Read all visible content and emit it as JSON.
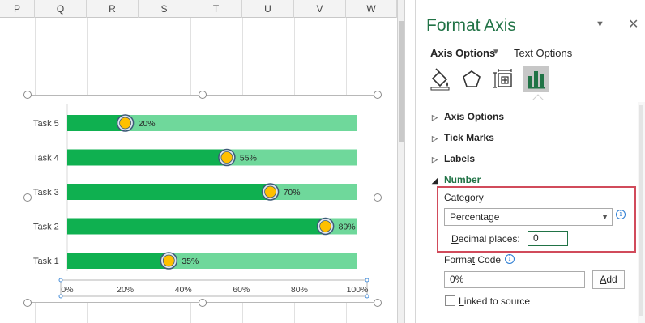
{
  "sheet": {
    "columns": [
      "P",
      "Q",
      "R",
      "S",
      "T",
      "U",
      "V",
      "W"
    ]
  },
  "chart_data": {
    "type": "bar",
    "orientation": "horizontal",
    "categories": [
      "Task 1",
      "Task 2",
      "Task 3",
      "Task 4",
      "Task 5"
    ],
    "values": [
      0.35,
      0.89,
      0.7,
      0.55,
      0.2
    ],
    "data_labels": [
      "35%",
      "89%",
      "70%",
      "55%",
      "20%"
    ],
    "xlim": [
      0,
      1
    ],
    "x_ticks": [
      "0%",
      "20%",
      "40%",
      "60%",
      "80%",
      "100%"
    ],
    "grid": false,
    "colors": {
      "progress": "#0fb050",
      "remaining": "#6fd89b",
      "marker_fill": "#ffc000",
      "marker_ring": "#3c5a78"
    }
  },
  "pane": {
    "title": "Format Axis",
    "tabs": {
      "axis_options": "Axis Options",
      "text_options": "Text Options"
    },
    "icons": [
      "fill-line-icon",
      "effects-icon",
      "size-properties-icon",
      "axis-options-icon"
    ],
    "sections": {
      "axis_options": "Axis Options",
      "tick_marks": "Tick Marks",
      "labels": "Labels",
      "number": "Number"
    },
    "number": {
      "category_label": "Category",
      "category_value": "Percentage",
      "decimal_label": "Decimal places:",
      "decimal_value": "0",
      "format_code_label": "Format Code",
      "format_code_value": "0%",
      "add_label": "Add",
      "linked_label": "Linked to source",
      "linked_checked": false
    },
    "accent_color": "#217346",
    "highlight_color": "#d14b5b"
  }
}
